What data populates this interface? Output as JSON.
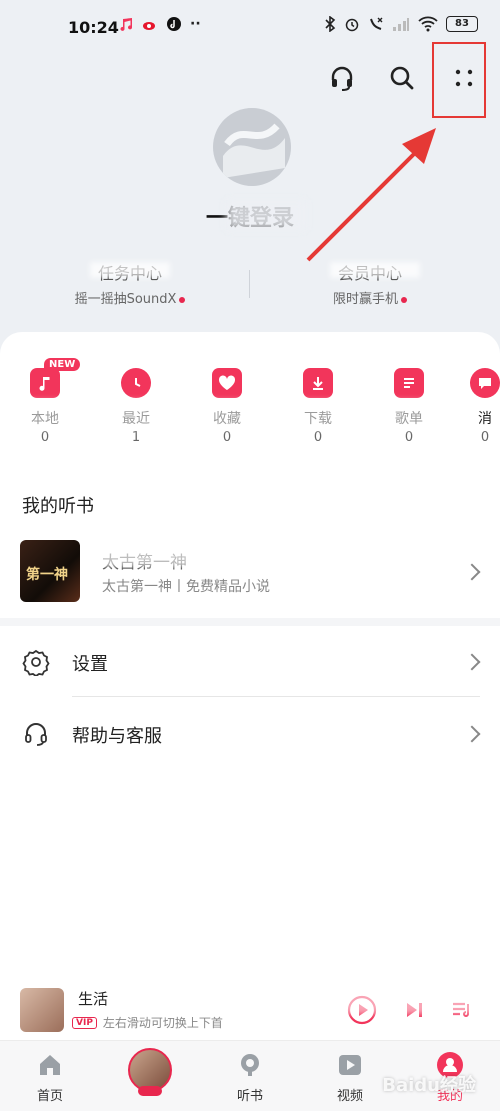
{
  "status_bar": {
    "time": "10:24",
    "battery": "83"
  },
  "colors": {
    "accent": "#f2355b",
    "annotation": "#e53935",
    "bg_top": "#edf0f4"
  },
  "header": {
    "icons": [
      "headset-icon",
      "search-icon",
      "more-dots-icon"
    ]
  },
  "profile": {
    "username": "一键登录",
    "stats": [
      {
        "title": "任务中心",
        "sub": "摇一摇抽SoundX"
      },
      {
        "title": "会员中心",
        "sub": "限时赢手机"
      }
    ]
  },
  "quick_actions": {
    "new_badge": "NEW",
    "items": [
      {
        "label": "本地",
        "count": "0",
        "icon": "music-note-icon"
      },
      {
        "label": "最近",
        "count": "1",
        "icon": "clock-icon"
      },
      {
        "label": "收藏",
        "count": "0",
        "icon": "heart-icon"
      },
      {
        "label": "下载",
        "count": "0",
        "icon": "download-icon"
      },
      {
        "label": "歌单",
        "count": "0",
        "icon": "playlist-icon"
      },
      {
        "label": "消",
        "count": "0",
        "icon": "message-icon"
      }
    ]
  },
  "audiobooks": {
    "section_title": "我的听书",
    "book": {
      "title": "太古第一神",
      "subtitle": "太古第一神丨免费精品小说",
      "cover_text": "第一神"
    }
  },
  "menu": [
    {
      "label": "设置",
      "icon": "gear-icon"
    },
    {
      "label": "帮助与客服",
      "icon": "headset-icon"
    }
  ],
  "player": {
    "title": "生活",
    "vip": "VIP",
    "hint": "左右滑动可切换上下首"
  },
  "tabbar": {
    "tabs": [
      {
        "label": "首页",
        "icon": "home-icon"
      },
      {
        "label": "听书",
        "icon": "podcast-icon"
      },
      {
        "label": "视频",
        "icon": "video-icon"
      },
      {
        "label": "我的",
        "icon": "profile-icon"
      }
    ]
  },
  "watermark": "Baidu经验"
}
